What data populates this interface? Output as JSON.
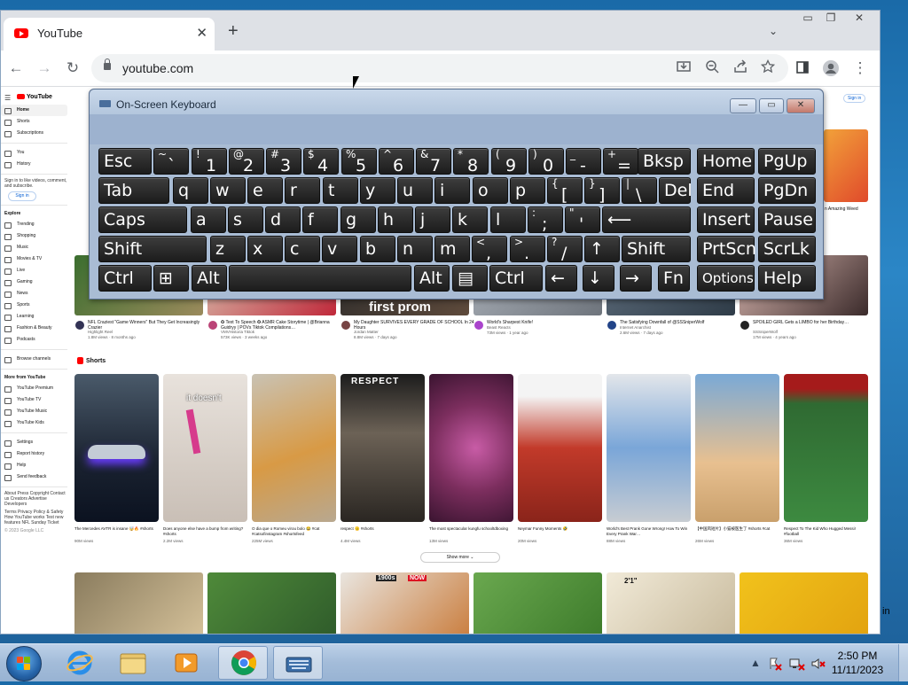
{
  "browser": {
    "tab_title": "YouTube",
    "tab_close": "✕",
    "new_tab": "+",
    "tab_search": "⌄",
    "url": "youtube.com",
    "win_min": "▭",
    "win_restore": "❐",
    "win_close": "✕",
    "back": "←",
    "forward": "→",
    "reload": "↻",
    "menu": "⋮"
  },
  "youtube": {
    "logo": "YouTube",
    "sign_in_top": "Sign in",
    "sidebar": {
      "items1": [
        "Home",
        "Shorts",
        "Subscriptions"
      ],
      "items2": [
        "You",
        "History"
      ],
      "signin_text": "Sign in to like videos, comment, and subscribe.",
      "signin_button": "Sign in",
      "explore_head": "Explore",
      "explore": [
        "Trending",
        "Shopping",
        "Music",
        "Movies & TV",
        "Live",
        "Gaming",
        "News",
        "Sports",
        "Learning",
        "Fashion & Beauty",
        "Podcasts"
      ],
      "browse": "Browse channels",
      "more_head": "More from YouTube",
      "more": [
        "YouTube Premium",
        "YouTube TV",
        "YouTube Music",
        "YouTube Kids"
      ],
      "settings": [
        "Settings",
        "Report history",
        "Help",
        "Send feedback"
      ],
      "footer1": "About Press Copyright Contact us Creators Advertise Developers",
      "footer2": "Terms Privacy Policy & Safety How YouTube works Test new features NFL Sunday Ticket",
      "copyright": "© 2023 Google LLC"
    },
    "videos": [
      {
        "title": "NFL Craziest \"Game Winners\" But They Get Increasingly Crazier",
        "channel": "Highlight Reel",
        "meta": "1.8M views · 8 months ago"
      },
      {
        "title": "✪ Text To Speech ✪ ASMR Cake Storytime | @Brianna Guidryy | POVs Tiktok Compilations…",
        "channel": "VMVHistoria Tiktok",
        "meta": "573K views · 3 weeks ago"
      },
      {
        "title": "My Daughter SURVIVES EVERY GRADE OF SCHOOL In 24 Hours",
        "channel": "Jordan Matter",
        "meta": "8.8M views · 7 days ago"
      },
      {
        "title": "World's Sharpest Knife!",
        "channel": "Beast Reacts",
        "meta": "73M views · 1 year ago"
      },
      {
        "title": "The Satisfying Downfall of @SSSniperWolf",
        "channel": "Internet Anarchist",
        "meta": "2.6M views · 7 days ago"
      },
      {
        "title": "SPOILED GIRL Gets a LIMBO for her Birthday…",
        "channel": "SSSniperWolf",
        "meta": "17M views · 4 years ago"
      }
    ],
    "thumb_text": "first prom",
    "right_snippet": "n Amazing Weed",
    "shorts_head": "Shorts",
    "shorts": [
      {
        "title": "The Mercedes AVTR is insane 🤯🔥 #shorts",
        "views": "90M views"
      },
      {
        "title": "Does anyone else have a bump from writing? #shorts",
        "views": "2.2M views"
      },
      {
        "title": "O dia que o Romeu virou bolo 😂 #cat #catsofinstagram #shortsfeed",
        "views": "225M views"
      },
      {
        "title": "respect 🫡 #shorts",
        "views": "4.4M views"
      },
      {
        "title": "The most spectacular kungfu schooltdboxing",
        "views": "13M views"
      },
      {
        "title": "Neymar Funny Moments 🤣",
        "views": "20M views"
      },
      {
        "title": "World's Best Prank Gone Wrong! How To Win Every Prank War…",
        "views": "88M views"
      },
      {
        "title": "【中国风短片】小猫被医生了 #shorts #cat",
        "views": "26M views"
      },
      {
        "title": "Respect To The Kid Who Hugged Messi! #football",
        "views": "36M views"
      }
    ],
    "short_overlay_1": "it doesn't",
    "short_overlay_2": "RESPECT",
    "show_more": "Show more ⌄",
    "bottom_labels": [
      "1900s",
      "NOW",
      "2'1\""
    ],
    "edge_text": "in"
  },
  "osk": {
    "title": "On-Screen Keyboard",
    "min": "—",
    "max": "▭",
    "close": "✕",
    "rows": [
      [
        {
          "l": "Esc"
        },
        {
          "t": "~",
          "b": "`"
        },
        {
          "t": "!",
          "b": "1"
        },
        {
          "t": "@",
          "b": "2"
        },
        {
          "t": "#",
          "b": "3"
        },
        {
          "t": "$",
          "b": "4"
        },
        {
          "t": "%",
          "b": "5"
        },
        {
          "t": "^",
          "b": "6"
        },
        {
          "t": "&",
          "b": "7"
        },
        {
          "t": "*",
          "b": "8"
        },
        {
          "t": "(",
          "b": "9"
        },
        {
          "t": ")",
          "b": "0"
        },
        {
          "t": "_",
          "b": "-"
        },
        {
          "t": "+",
          "b": "="
        },
        {
          "l": "Bksp"
        },
        {
          "l": "Home"
        },
        {
          "l": "PgUp"
        }
      ],
      [
        {
          "l": "Tab"
        },
        {
          "l": "q"
        },
        {
          "l": "w"
        },
        {
          "l": "e"
        },
        {
          "l": "r"
        },
        {
          "l": "t"
        },
        {
          "l": "y"
        },
        {
          "l": "u"
        },
        {
          "l": "i"
        },
        {
          "l": "o"
        },
        {
          "l": "p"
        },
        {
          "t": "{",
          "b": "["
        },
        {
          "t": "}",
          "b": "]"
        },
        {
          "t": "|",
          "b": "\\"
        },
        {
          "l": "Del"
        },
        {
          "l": "End"
        },
        {
          "l": "PgDn"
        }
      ],
      [
        {
          "l": "Caps"
        },
        {
          "l": "a"
        },
        {
          "l": "s"
        },
        {
          "l": "d"
        },
        {
          "l": "f"
        },
        {
          "l": "g"
        },
        {
          "l": "h"
        },
        {
          "l": "j"
        },
        {
          "l": "k"
        },
        {
          "l": "l"
        },
        {
          "t": ":",
          "b": ";"
        },
        {
          "t": "\"",
          "b": "'"
        },
        {
          "l": "⟵"
        },
        {
          "l": "Insert"
        },
        {
          "l": "Pause"
        }
      ],
      [
        {
          "l": "Shift"
        },
        {
          "l": "z"
        },
        {
          "l": "x"
        },
        {
          "l": "c"
        },
        {
          "l": "v"
        },
        {
          "l": "b"
        },
        {
          "l": "n"
        },
        {
          "l": "m"
        },
        {
          "t": "<",
          "b": ","
        },
        {
          "t": ">",
          "b": "."
        },
        {
          "t": "?",
          "b": "/"
        },
        {
          "l": "↑"
        },
        {
          "l": "Shift"
        },
        {
          "l": "PrtScn"
        },
        {
          "l": "ScrLk"
        }
      ],
      [
        {
          "l": "Ctrl"
        },
        {
          "l": "⊞"
        },
        {
          "l": "Alt"
        },
        {
          "l": ""
        },
        {
          "l": "Alt"
        },
        {
          "l": "▤"
        },
        {
          "l": "Ctrl"
        },
        {
          "l": "←"
        },
        {
          "l": "↓"
        },
        {
          "l": "→"
        },
        {
          "l": "Fn"
        },
        {
          "l": "Options"
        },
        {
          "l": "Help"
        }
      ]
    ]
  },
  "taskbar": {
    "time": "2:50 PM",
    "date": "11/11/2023",
    "tray_up": "▲"
  },
  "colors": {
    "yt_red": "#ff0000",
    "key_bg": "#1c1c1c",
    "osk_bg": "#a9bcd4"
  }
}
